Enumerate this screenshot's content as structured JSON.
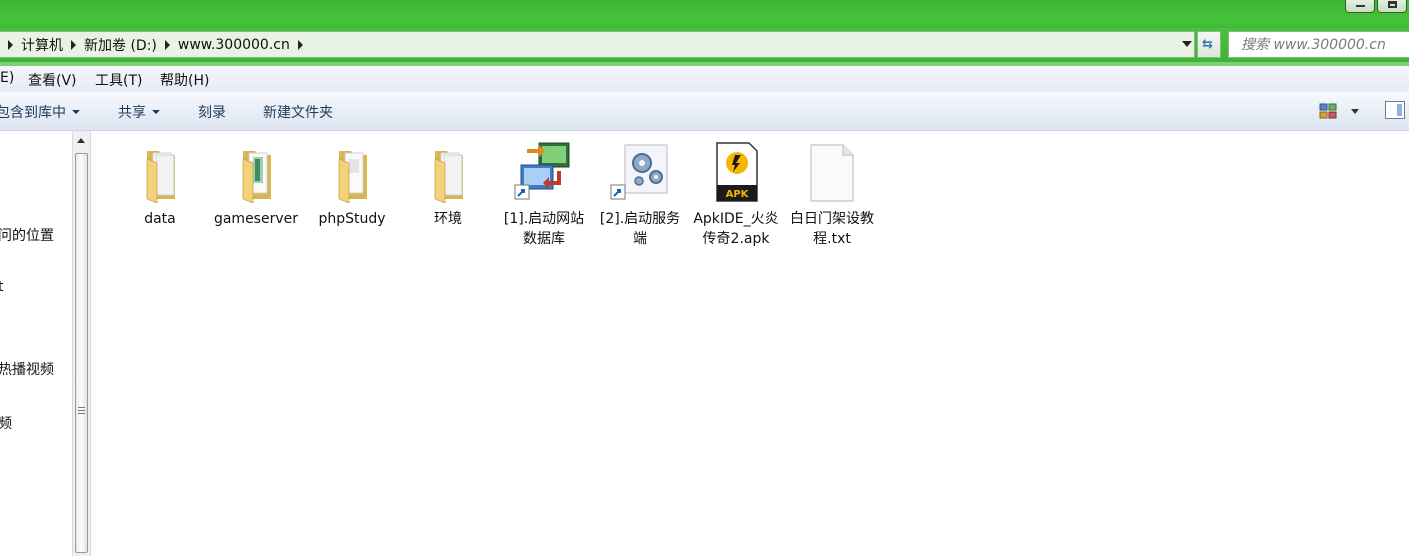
{
  "address": {
    "crumbs": [
      "计算机",
      "新加卷 (D:)",
      "www.300000.cn"
    ]
  },
  "search": {
    "placeholder": "搜索 www.300000.cn"
  },
  "menu": {
    "items": [
      "E)",
      "查看(V)",
      "工具(T)",
      "帮助(H)"
    ]
  },
  "toolbar": {
    "include_library": "包含到库中",
    "share": "共享",
    "burn": "刻录",
    "new_folder": "新建文件夹"
  },
  "nav": {
    "items": [
      "问的位置",
      "t",
      "热播视频",
      "频"
    ]
  },
  "files": [
    {
      "name": "data",
      "icon": "folder-icon"
    },
    {
      "name": "gameserver",
      "icon": "folder-icon"
    },
    {
      "name": "phpStudy",
      "icon": "folder-icon"
    },
    {
      "name": "环境",
      "icon": "folder-icon"
    },
    {
      "name": "[1].启动网站数据库",
      "icon": "shortcut-network-icon"
    },
    {
      "name": "[2].启动服务端",
      "icon": "shortcut-gears-icon"
    },
    {
      "name": "ApkIDE_火炎传奇2.apk",
      "icon": "apk-file-icon"
    },
    {
      "name": "白日门架设教程.txt",
      "icon": "text-file-icon"
    }
  ],
  "colors": {
    "title_green": "#46c23d",
    "folder_yellow": "#f2d27a",
    "apk_dark": "#1b1b1b",
    "apk_accent": "#f5b800"
  },
  "icons": {
    "views": "view-options-icon",
    "preview_pane": "preview-pane-icon",
    "refresh": "refresh-icon"
  }
}
